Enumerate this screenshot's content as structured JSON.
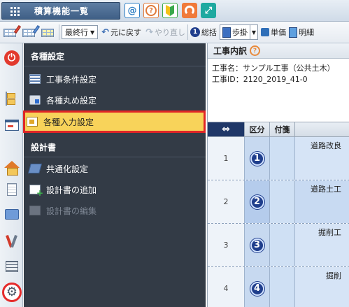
{
  "topbar": {
    "app_title": "積算機能一覧",
    "at_label": "@",
    "help_label": "?",
    "expand_label": "⤢"
  },
  "toolbar": {
    "sort_select": "最終行",
    "undo_label": "元に戻す",
    "redo_label": "やり直し",
    "summary_badge": "1",
    "summary_label": "総括",
    "step_label": "歩掛",
    "unit_price_label": "単価",
    "detail_label": "明細"
  },
  "menu": {
    "section_general": "各種設定",
    "items_general": [
      {
        "label": "工事条件設定",
        "icon": "list-icon"
      },
      {
        "label": "各種丸め設定",
        "icon": "rounding-icon"
      },
      {
        "label": "各種入力設定",
        "icon": "input-settings-icon",
        "active": true
      }
    ],
    "section_design": "設計書",
    "items_design": [
      {
        "label": "共通化設定",
        "icon": "common-icon"
      },
      {
        "label": "設計書の追加",
        "icon": "add-document-icon"
      },
      {
        "label": "設計書の編集",
        "icon": "edit-document-icon",
        "disabled": true
      }
    ]
  },
  "content": {
    "header_title": "工事内訳",
    "project_name": "工事名：サンプル工事（公共土木）",
    "project_id": "工事ID：2120_2019_41-0",
    "grid": {
      "col_swap": "⇔",
      "col_kubun": "区分",
      "col_fusen": "付箋",
      "rows": [
        {
          "no": "1",
          "badge": "1",
          "name": "道路改良"
        },
        {
          "no": "2",
          "badge": "2",
          "name": "道路土工"
        },
        {
          "no": "3",
          "badge": "3",
          "name": "掘削工"
        },
        {
          "no": "4",
          "badge": "4",
          "name": "掘削"
        }
      ]
    }
  },
  "colors": {
    "accent_dark": "#333b46",
    "highlight_yellow": "#f8d35a",
    "highlight_border": "#e02626",
    "badge_navy": "#1f3e8c"
  }
}
